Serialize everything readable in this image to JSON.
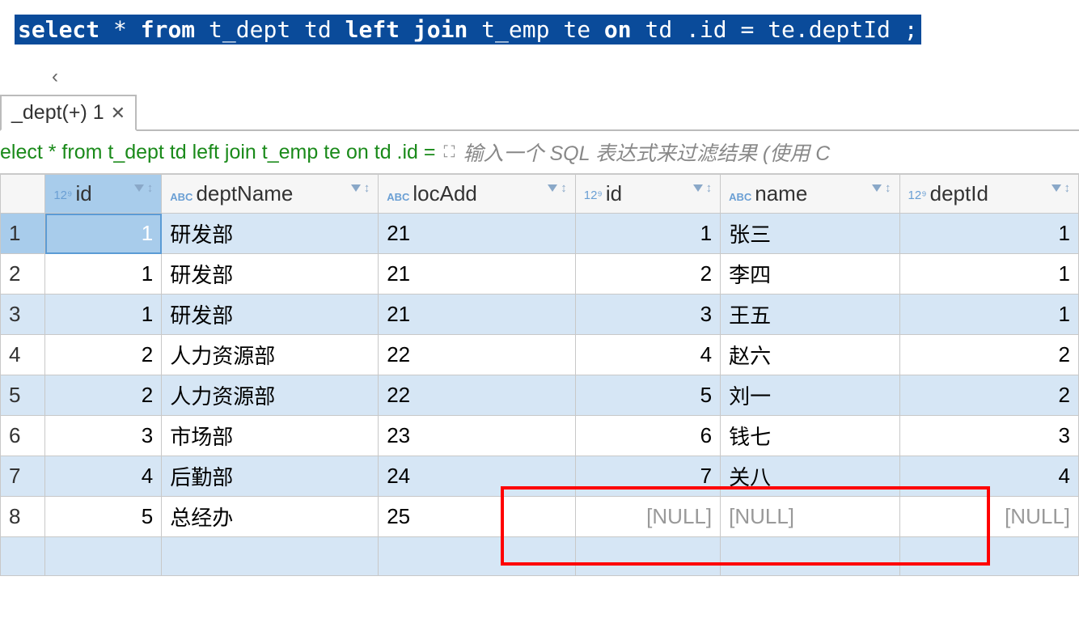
{
  "sql": {
    "tokens": [
      "select",
      " * ",
      "from",
      " t_dept td ",
      "left join",
      " t_emp te ",
      "on",
      " td .id = te.deptId  ;"
    ]
  },
  "tab": {
    "label": "_dept(+) 1"
  },
  "query_bar": {
    "text": "elect * from t_dept td left join t_emp te on td .id =",
    "filter_placeholder": "输入一个 SQL 表达式来过滤结果 (使用 C"
  },
  "columns": [
    {
      "name": "id",
      "type": "num"
    },
    {
      "name": "deptName",
      "type": "abc"
    },
    {
      "name": "locAdd",
      "type": "abc"
    },
    {
      "name": "id",
      "type": "num"
    },
    {
      "name": "name",
      "type": "abc"
    },
    {
      "name": "deptId",
      "type": "num"
    }
  ],
  "rows": [
    {
      "n": "1",
      "id1": "1",
      "deptName": "研发部",
      "locAdd": "21",
      "id2": "1",
      "name": "张三",
      "deptId": "1"
    },
    {
      "n": "2",
      "id1": "1",
      "deptName": "研发部",
      "locAdd": "21",
      "id2": "2",
      "name": "李四",
      "deptId": "1"
    },
    {
      "n": "3",
      "id1": "1",
      "deptName": "研发部",
      "locAdd": "21",
      "id2": "3",
      "name": "王五",
      "deptId": "1"
    },
    {
      "n": "4",
      "id1": "2",
      "deptName": "人力资源部",
      "locAdd": "22",
      "id2": "4",
      "name": "赵六",
      "deptId": "2"
    },
    {
      "n": "5",
      "id1": "2",
      "deptName": "人力资源部",
      "locAdd": "22",
      "id2": "5",
      "name": "刘一",
      "deptId": "2"
    },
    {
      "n": "6",
      "id1": "3",
      "deptName": "市场部",
      "locAdd": "23",
      "id2": "6",
      "name": "钱七",
      "deptId": "3"
    },
    {
      "n": "7",
      "id1": "4",
      "deptName": "后勤部",
      "locAdd": "24",
      "id2": "7",
      "name": "关八",
      "deptId": "4"
    },
    {
      "n": "8",
      "id1": "5",
      "deptName": "总经办",
      "locAdd": "25",
      "id2": "[NULL]",
      "name": "[NULL]",
      "deptId": "[NULL]"
    }
  ]
}
